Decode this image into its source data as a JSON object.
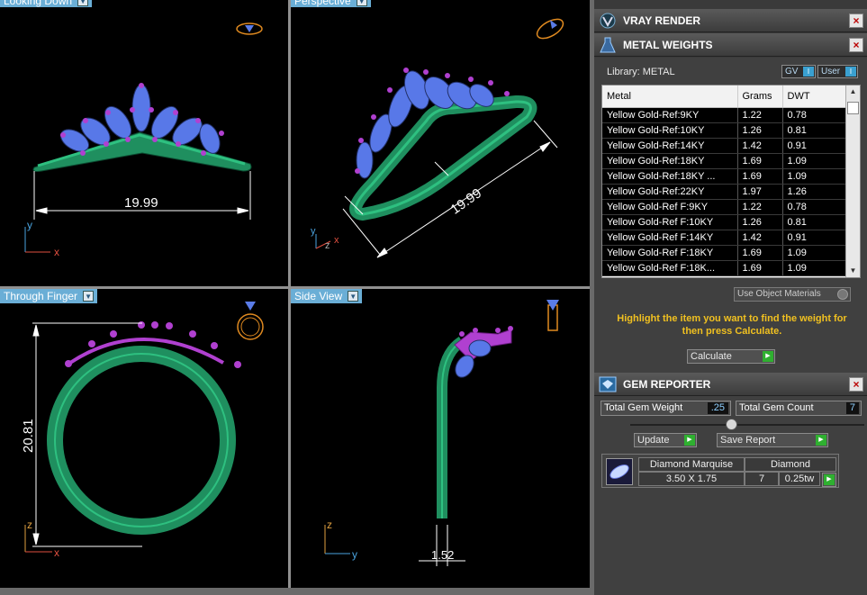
{
  "viewports": {
    "top_left": {
      "label": "Looking Down",
      "dimension": "19.99",
      "axis_v": "y",
      "axis_h": "x"
    },
    "top_right": {
      "label": "Perspective",
      "dimension": "19.99",
      "axis_v": "y",
      "axis_h": "x",
      "axis_z": "z"
    },
    "bottom_left": {
      "label": "Through Finger",
      "dimension": "20.81",
      "axis_v": "z",
      "axis_h": "x"
    },
    "bottom_right": {
      "label": "Side View",
      "dimension": "1.52",
      "axis_v": "z",
      "axis_h": "y"
    }
  },
  "panels": {
    "vray": {
      "title": "VRAY RENDER",
      "close": "×"
    },
    "metal_weights": {
      "title": "METAL WEIGHTS",
      "close": "×",
      "library": "Library: METAL",
      "toggle_gv": "GV",
      "toggle_user": "User",
      "columns": [
        "Metal",
        "Grams",
        "DWT"
      ],
      "rows": [
        [
          "Yellow Gold-Ref:9KY",
          "1.22",
          "0.78"
        ],
        [
          "Yellow Gold-Ref:10KY",
          "1.26",
          "0.81"
        ],
        [
          "Yellow Gold-Ref:14KY",
          "1.42",
          "0.91"
        ],
        [
          "Yellow Gold-Ref:18KY",
          "1.69",
          "1.09"
        ],
        [
          "Yellow Gold-Ref:18KY ...",
          "1.69",
          "1.09"
        ],
        [
          "Yellow Gold-Ref:22KY",
          "1.97",
          "1.26"
        ],
        [
          "Yellow Gold-Ref F:9KY",
          "1.22",
          "0.78"
        ],
        [
          "Yellow Gold-Ref F:10KY",
          "1.26",
          "0.81"
        ],
        [
          "Yellow Gold-Ref F:14KY",
          "1.42",
          "0.91"
        ],
        [
          "Yellow Gold-Ref F:18KY",
          "1.69",
          "1.09"
        ],
        [
          "Yellow Gold-Ref F:18K...",
          "1.69",
          "1.09"
        ]
      ],
      "use_object_materials": "Use Object Materials",
      "hint": "Highlight the item you want to find the weight for then press Calculate.",
      "calculate": "Calculate"
    },
    "gem_reporter": {
      "title": "GEM REPORTER",
      "close": "×",
      "total_weight_label": "Total Gem Weight",
      "total_weight_value": ".25",
      "total_count_label": "Total Gem Count",
      "total_count_value": "7",
      "update": "Update",
      "save_report": "Save Report",
      "gem": {
        "name": "Diamond Marquise",
        "type": "Diamond",
        "size": "3.50 X 1.75",
        "count": "7",
        "weight": "0.25tw"
      }
    }
  },
  "colors": {
    "band": "#1f8f5f",
    "gem": "#5878e8",
    "prong": "#b040d0",
    "dimension": "#ffffff",
    "axis_y": "#4aa3df",
    "axis_x": "#e05040",
    "hint": "#f0c020"
  },
  "icons": {
    "vray": "vray-logo-icon",
    "metal": "flask-icon",
    "gem": "gem-report-icon",
    "go": "green-arrow-icon"
  }
}
